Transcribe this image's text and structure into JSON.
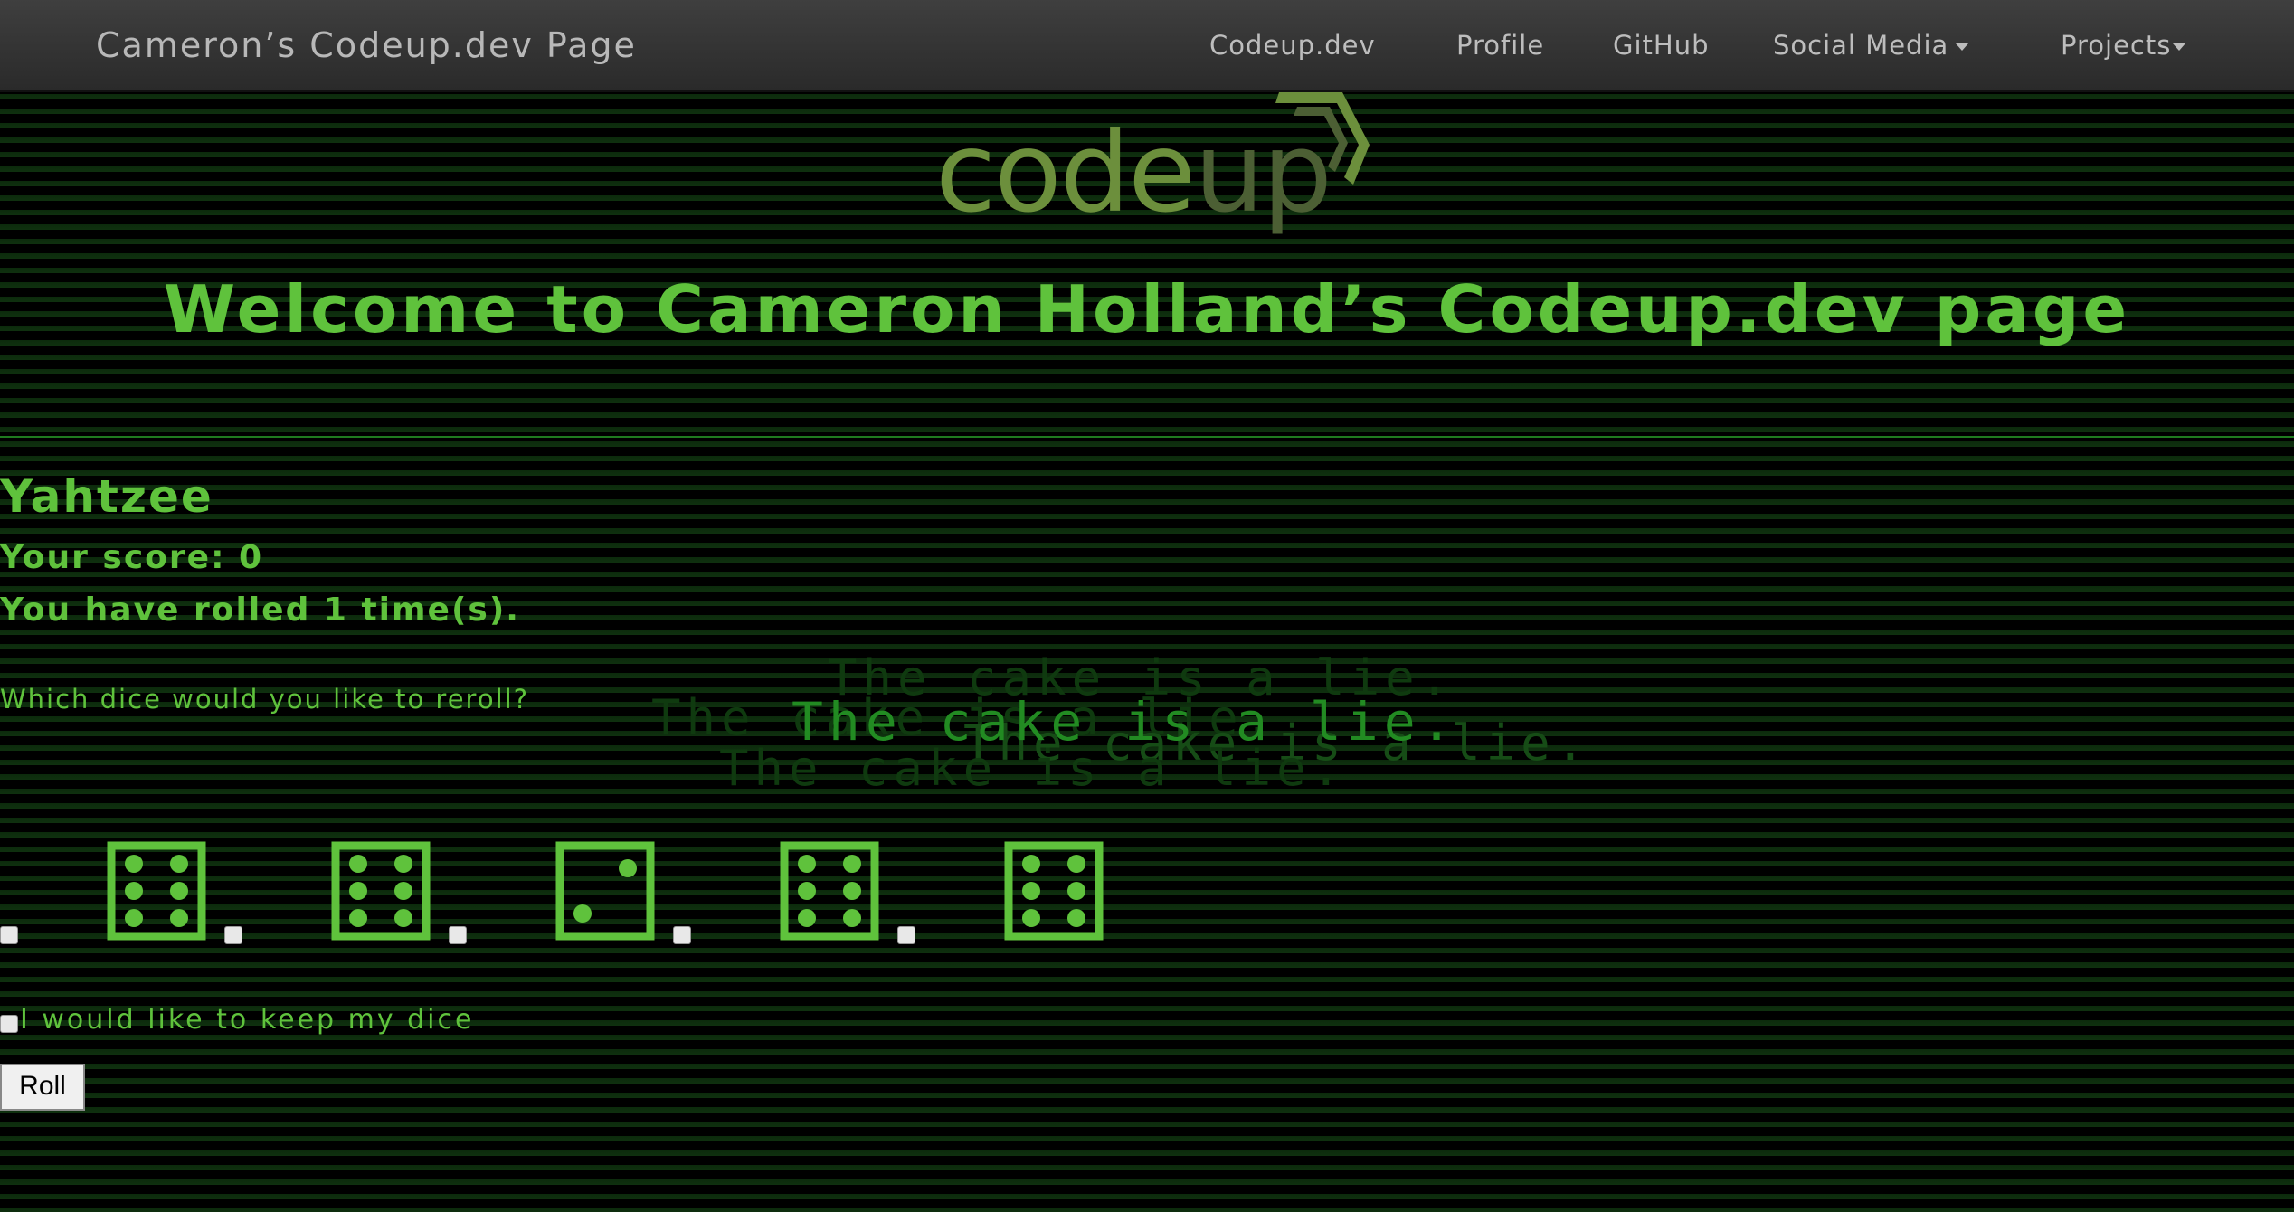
{
  "navbar": {
    "brand": "Cameron’s Codeup.dev Page",
    "items": [
      {
        "label": "Codeup.dev"
      },
      {
        "label": "Profile"
      },
      {
        "label": "GitHub"
      },
      {
        "label": "Social Media"
      },
      {
        "label": "Projects"
      }
    ]
  },
  "logo": {
    "text_a": "code",
    "text_b": "up"
  },
  "header": {
    "welcome": "Welcome to Cameron Holland’s Codeup.dev page"
  },
  "game": {
    "title": "Yahtzee",
    "score": "Your score: 0",
    "rolls": "You have rolled 1 time(s).",
    "question": "Which dice would you like to reroll?",
    "dice": [
      6,
      6,
      2,
      6,
      6
    ],
    "keep_label": "I would like to keep my dice",
    "roll_button": "Roll"
  },
  "background_text": {
    "phrase": "The cake is a lie."
  },
  "colors": {
    "accent": "#5fc23c",
    "background": "#000000",
    "navbar": "#333333"
  }
}
